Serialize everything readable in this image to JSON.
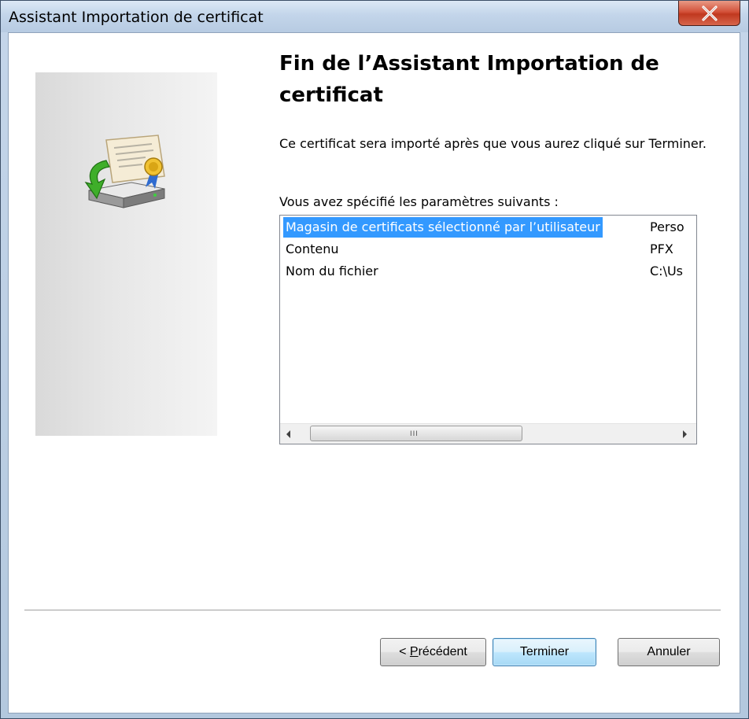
{
  "window": {
    "title": "Assistant Importation de certificat",
    "close_glyph": "X"
  },
  "side_panel": {
    "icon": "certificate-import-icon"
  },
  "main": {
    "heading": "Fin de l’Assistant Importation de certificat",
    "description": "Ce certificat sera importé après que vous aurez cliqué sur Terminer.",
    "list_label": "Vous avez spécifié les paramètres suivants :"
  },
  "settings_list": {
    "rows": [
      {
        "name": "Magasin de certificats sélectionné par l’utilisateur",
        "value": "Perso",
        "selected": true
      },
      {
        "name": "Contenu",
        "value": "PFX",
        "selected": false
      },
      {
        "name": "Nom du fichier",
        "value": "C:\\Us",
        "selected": false
      }
    ],
    "scrollbar": {
      "grip": "III",
      "thumb_fraction": 0.52
    }
  },
  "buttons": {
    "prev_prefix": "< ",
    "prev_mnemonic": "P",
    "prev_rest": "récédent",
    "finish": "Terminer",
    "cancel": "Annuler"
  },
  "colors": {
    "selection": "#3399ff",
    "close_button": "#c0381f",
    "default_button_border": "#3c7fb1"
  }
}
